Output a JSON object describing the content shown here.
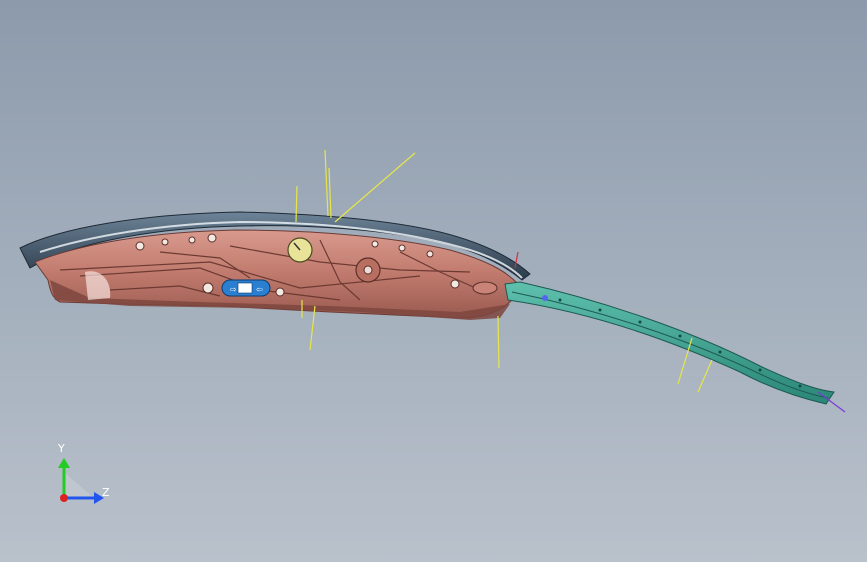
{
  "viewport": {
    "background_top": "#8c9aab",
    "background_bottom": "#b9c1cb"
  },
  "model": {
    "body_color": "#c98477",
    "rail_color": "#3fa594",
    "trim_color": "#2f4458",
    "guide_line_color": "#e6e64a",
    "badge_color": "#2a7fd0",
    "dial_color": "#e9e39a"
  },
  "triad": {
    "y_label": "Y",
    "z_label": "Z",
    "y_color": "#22cc22",
    "z_color": "#2255ee",
    "x_color": "#dd2222"
  }
}
